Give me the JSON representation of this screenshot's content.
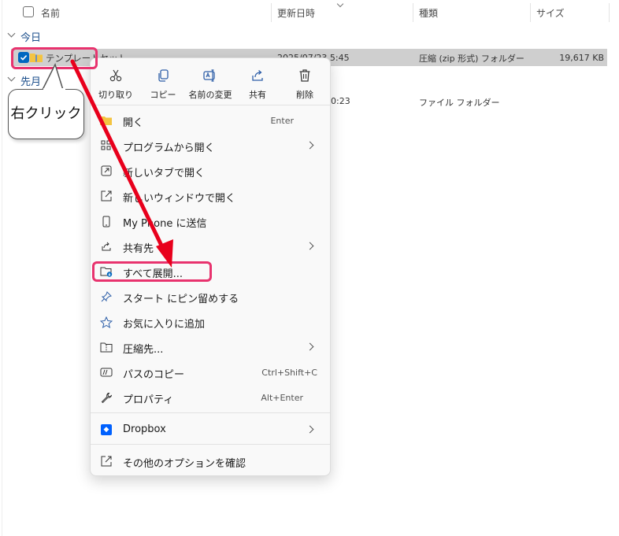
{
  "header": {
    "col_name": "名前",
    "col_date": "更新日時",
    "col_type": "種類",
    "col_size": "サイズ"
  },
  "groups": [
    {
      "label": "今日"
    },
    {
      "label": "先月"
    }
  ],
  "files": [
    {
      "name": "テンプレートセット.zip",
      "date": "2025/07/23 5:45",
      "type": "圧縮 (zip 形式) フォルダー",
      "size": "19,617 KB"
    },
    {
      "date_fragment": "0:23",
      "type": "ファイル フォルダー"
    }
  ],
  "callout": {
    "text": "右クリック"
  },
  "toolbar": [
    {
      "label": "切り取り",
      "icon": "scissors-icon"
    },
    {
      "label": "コピー",
      "icon": "copy-icon"
    },
    {
      "label": "名前の変更",
      "icon": "rename-icon"
    },
    {
      "label": "共有",
      "icon": "share-icon"
    },
    {
      "label": "削除",
      "icon": "trash-icon"
    }
  ],
  "menu_items": [
    {
      "label": "開く",
      "shortcut": "Enter",
      "icon": "folder-open-icon"
    },
    {
      "label": "プログラムから開く",
      "icon": "apps-icon",
      "submenu": true
    },
    {
      "label": "新しいタブで開く",
      "icon": "new-tab-icon"
    },
    {
      "label": "新しいウィンドウで開く",
      "icon": "new-window-icon"
    },
    {
      "label": "My Phone に送信",
      "icon": "phone-icon"
    },
    {
      "label": "共有先",
      "icon": "share-icon",
      "submenu": true
    },
    {
      "label": "すべて展開...",
      "icon": "extract-icon",
      "highlighted": true
    },
    {
      "label": "スタート にピン留めする",
      "icon": "pin-icon"
    },
    {
      "label": "お気に入りに追加",
      "icon": "star-icon"
    },
    {
      "label": "圧縮先...",
      "icon": "zip-icon",
      "submenu": true
    },
    {
      "label": "パスのコピー",
      "shortcut": "Ctrl+Shift+C",
      "icon": "path-copy-icon"
    },
    {
      "label": "プロパティ",
      "shortcut": "Alt+Enter",
      "icon": "wrench-icon"
    },
    {
      "label": "Dropbox",
      "icon": "dropbox-icon",
      "submenu": true
    },
    {
      "label": "その他のオプションを確認",
      "icon": "more-options-icon"
    }
  ],
  "colors": {
    "highlight": "#e8336e",
    "arrow": "#e8001c",
    "accent": "#0067c0"
  }
}
